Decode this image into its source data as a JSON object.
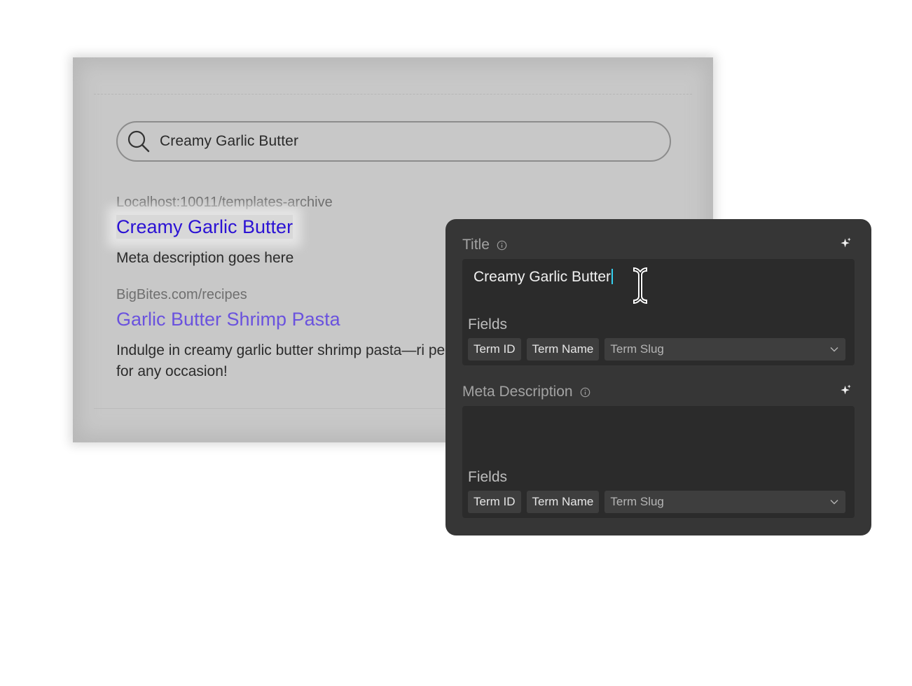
{
  "preview": {
    "search_query": "Creamy Garlic Butter",
    "results": [
      {
        "url": "Localhost:10011/templates-archive",
        "title": "Creamy Garlic Butter",
        "description": "Meta description goes here"
      },
      {
        "url": "BigBites.com/recipes",
        "title": "Garlic Butter Shrimp Pasta",
        "description": "Indulge in creamy garlic butter shrimp pasta—ri perfect for any occasion!"
      }
    ]
  },
  "panel": {
    "title_section": {
      "label": "Title",
      "value": "Creamy Garlic Butter",
      "fields_label": "Fields",
      "chips": [
        "Term ID",
        "Term Name"
      ],
      "select_label": "Term Slug"
    },
    "meta_section": {
      "label": "Meta Description",
      "value": "",
      "fields_label": "Fields",
      "chips": [
        "Term ID",
        "Term Name"
      ],
      "select_label": "Term Slug"
    }
  },
  "colors": {
    "panel_bg": "#363636",
    "field_bg": "#2b2b2b",
    "link_primary": "#2b12d4",
    "link_secondary": "#6a52de",
    "caret": "#35d0ef"
  },
  "icons": [
    "search-icon",
    "info-icon",
    "sparkle-icon",
    "chevron-down-icon",
    "text-cursor-icon"
  ]
}
